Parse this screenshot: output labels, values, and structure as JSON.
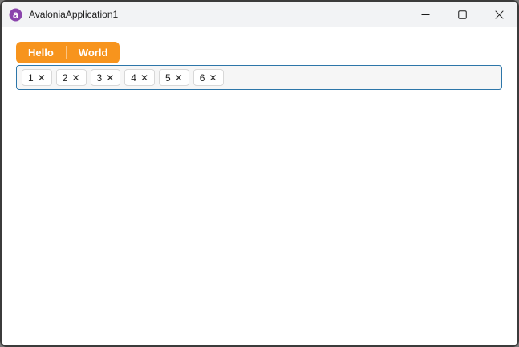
{
  "window": {
    "title": "AvaloniaApplication1",
    "icon": "avalonia-logo-icon"
  },
  "titlebar": {
    "buttons": [
      {
        "name": "minimize-button",
        "icon": "minimize-icon"
      },
      {
        "name": "maximize-button",
        "icon": "maximize-icon"
      },
      {
        "name": "close-button",
        "icon": "close-icon"
      }
    ]
  },
  "tabs": {
    "items": [
      {
        "label": "Hello"
      },
      {
        "label": "World"
      }
    ]
  },
  "tag_field": {
    "remove_icon_glyph": "✕",
    "chips": [
      {
        "label": "1"
      },
      {
        "label": "2"
      },
      {
        "label": "3"
      },
      {
        "label": "4"
      },
      {
        "label": "5"
      },
      {
        "label": "6"
      }
    ]
  },
  "colors": {
    "tab_accent_orange": "#F7941D",
    "field_focus_border_blue": "#2D76A9",
    "window_border": "#3B3B3B",
    "titlebar_bg": "#F2F3F5",
    "avalonia_logo_purple": "#8B44AC",
    "chip_border_gray": "#D8D8D8"
  }
}
